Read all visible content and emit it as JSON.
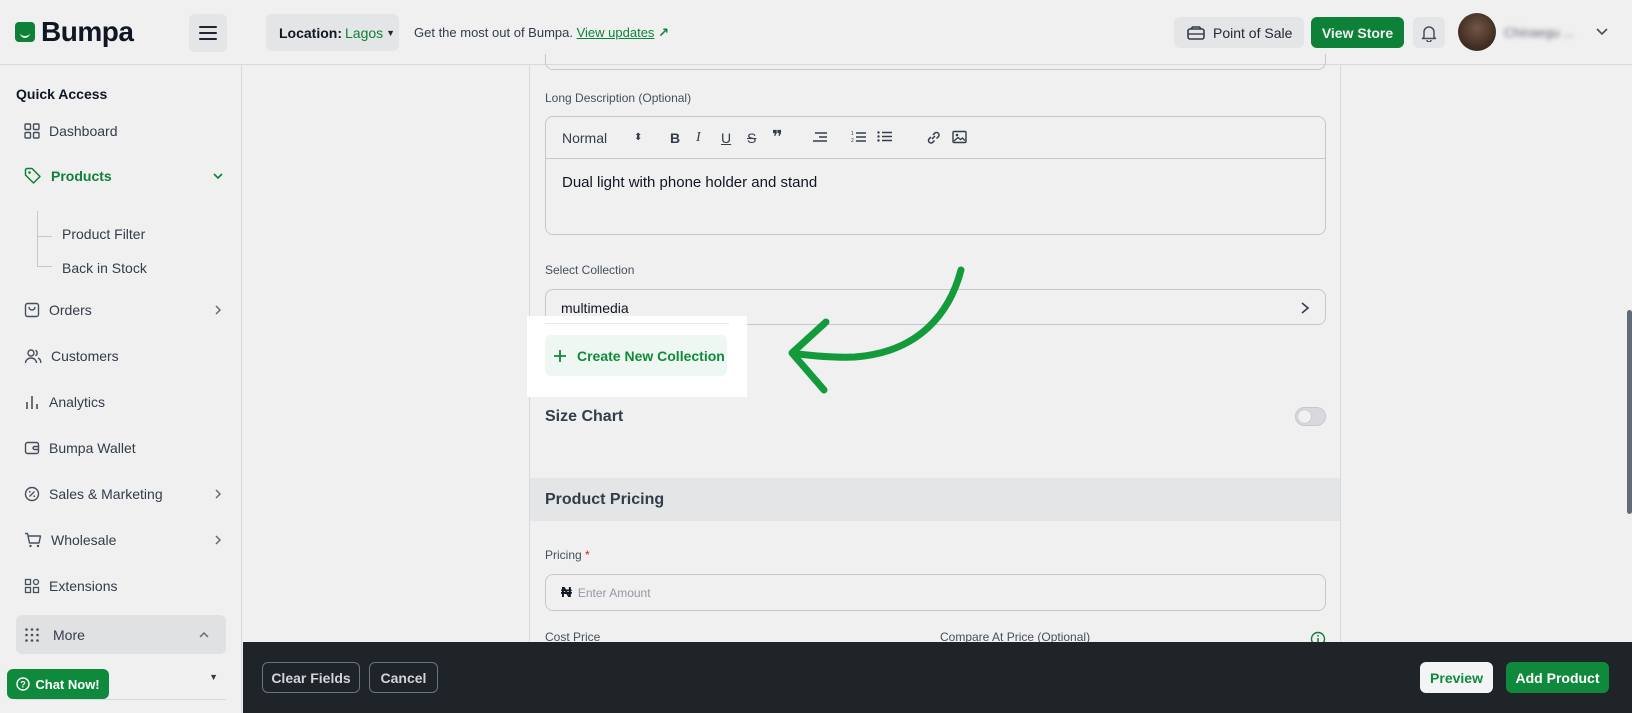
{
  "brand": {
    "name": "Bumpa",
    "accent": "#0f8a3c"
  },
  "topbar": {
    "location_label": "Location:",
    "location_value": "Lagos",
    "update_prefix": "Get the most out of Bumpa.",
    "update_link": "View updates",
    "pos_label": "Point of Sale",
    "view_store_label": "View Store",
    "user_name": "Chinaegu ..."
  },
  "sidebar": {
    "section_title": "Quick Access",
    "items": {
      "dashboard": "Dashboard",
      "products": "Products",
      "product_filter": "Product Filter",
      "back_in_stock": "Back in Stock",
      "orders": "Orders",
      "customers": "Customers",
      "analytics": "Analytics",
      "wallet": "Bumpa Wallet",
      "sales_marketing": "Sales & Marketing",
      "wholesale": "Wholesale",
      "extensions": "Extensions",
      "more": "More"
    },
    "chat_label": "Chat Now!"
  },
  "form": {
    "long_description_label": "Long Description (Optional)",
    "editor_format": "Normal",
    "long_description_value": "Dual light with phone holder and stand",
    "collection_label": "Select Collection",
    "collection_value": "multimedia",
    "create_collection_label": "Create New Collection",
    "size_chart_label": "Size Chart",
    "size_chart_enabled": false,
    "pricing_section": "Product Pricing",
    "pricing_label": "Pricing",
    "required_mark": "*",
    "currency_symbol": "₦",
    "pricing_placeholder": "Enter Amount",
    "cost_price_label": "Cost Price",
    "compare_price_label": "Compare At Price (Optional)"
  },
  "footer": {
    "clear_label": "Clear Fields",
    "cancel_label": "Cancel",
    "preview_label": "Preview",
    "add_label": "Add Product"
  }
}
